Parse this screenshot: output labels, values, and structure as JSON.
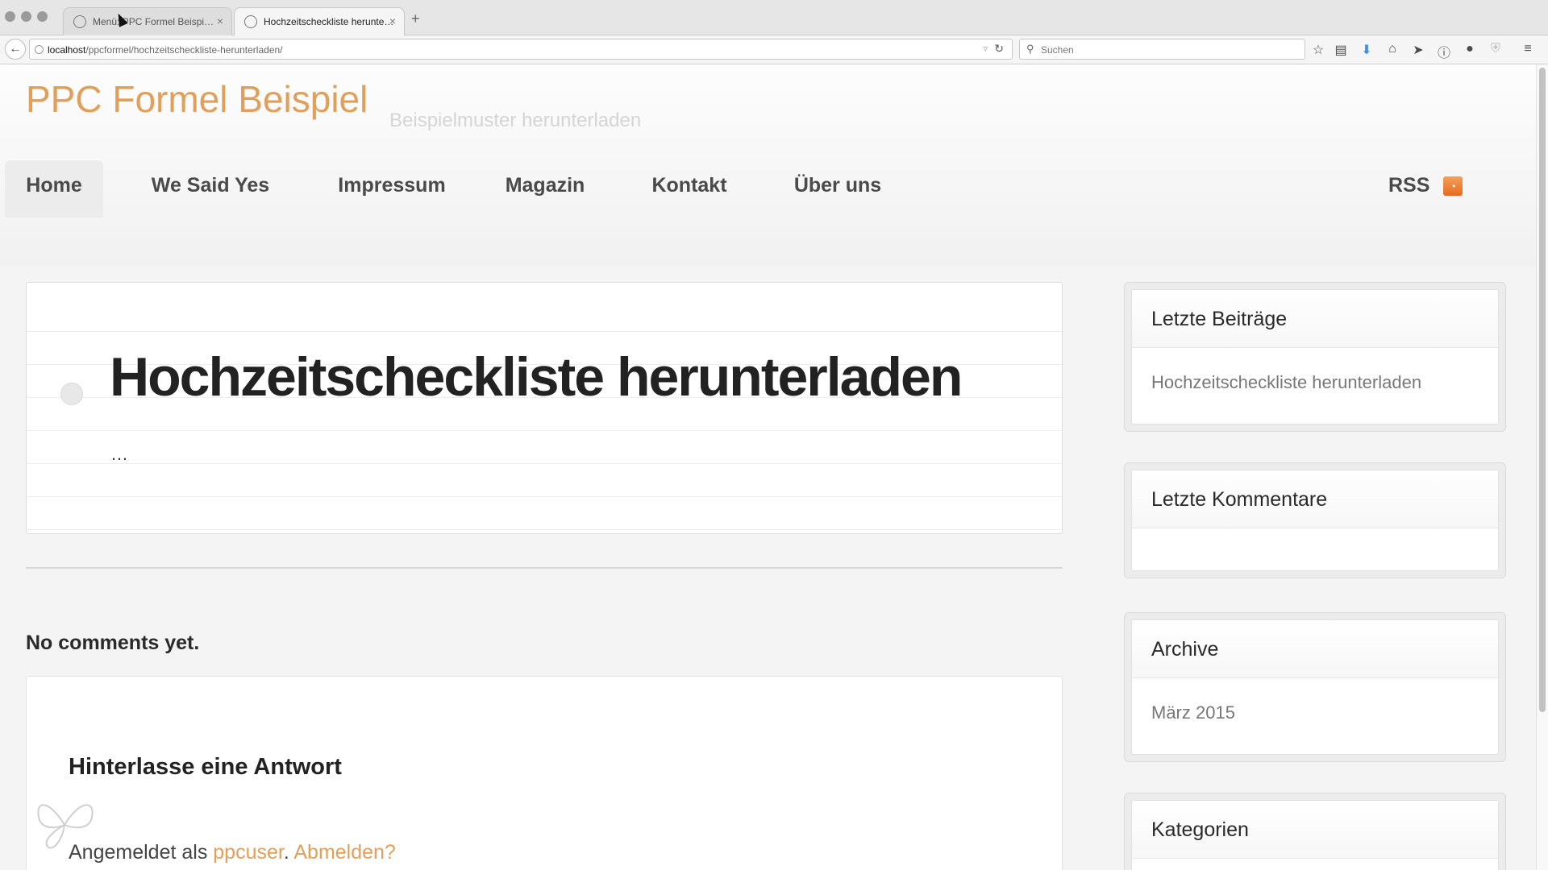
{
  "browser": {
    "tabs": [
      {
        "title": "Menü: PPC Formel Beispi…"
      },
      {
        "title": "Hochzeitscheckliste herunte…"
      }
    ],
    "new_tab": "+",
    "close_glyph": "×",
    "url_host": "localhost",
    "url_path": "/ppcformel/hochzeitscheckliste-herunterladen/",
    "search_placeholder": "Suchen",
    "toolbar_icons": [
      "star-icon",
      "reading-list-icon",
      "download-icon",
      "home-icon",
      "send-icon",
      "info-icon",
      "chat-icon",
      "shield-icon",
      "menu-icon"
    ]
  },
  "site": {
    "title": "PPC Formel Beispiel",
    "description": "Beispielmuster herunterladen",
    "accent_color": "#e0a05c"
  },
  "menu": {
    "items": [
      {
        "label": "Home"
      },
      {
        "label": "We Said Yes"
      },
      {
        "label": "Impressum"
      },
      {
        "label": "Magazin"
      },
      {
        "label": "Kontakt"
      },
      {
        "label": "Über uns"
      }
    ],
    "rss": "RSS"
  },
  "post": {
    "title": "Hochzeitscheckliste herunterladen",
    "excerpt": "…"
  },
  "comments": {
    "none": "No comments yet.",
    "reply_title": "Hinterlasse eine Antwort",
    "logged_in_prefix": "Angemeldet als ",
    "user": "ppcuser",
    "separator": ". ",
    "logout": "Abmelden?"
  },
  "sidebar": {
    "recent_posts": {
      "title": "Letzte Beiträge",
      "items": [
        "Hochzeitscheckliste herunterladen"
      ]
    },
    "recent_comments": {
      "title": "Letzte Kommentare"
    },
    "archive": {
      "title": "Archive",
      "items": [
        "März 2015"
      ]
    },
    "categories": {
      "title": "Kategorien"
    }
  }
}
